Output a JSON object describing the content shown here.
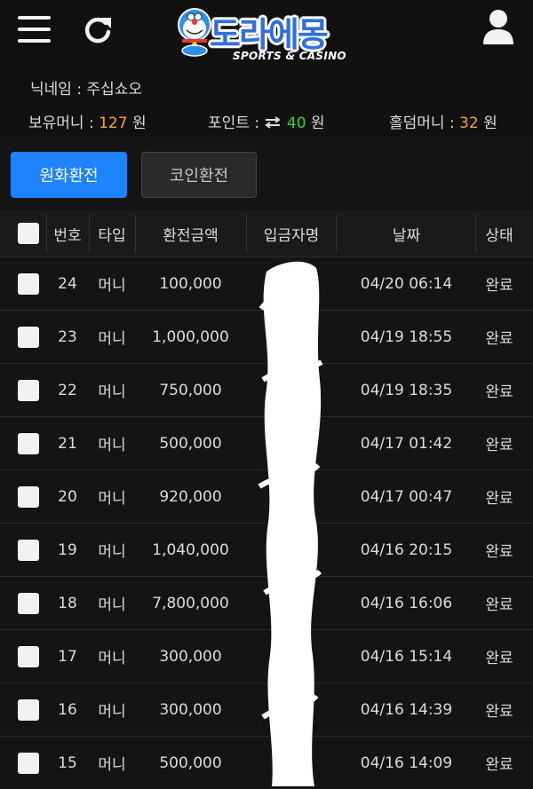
{
  "header": {
    "logo_text": "도라에몽",
    "logo_subtitle": "SPORTS & CASINO"
  },
  "info": {
    "nickname_label": "닉네임 : 주십쇼오",
    "balance_label": "보유머니 : ",
    "balance_value": "127",
    "points_label": "포인트 : ",
    "points_value": "40",
    "holdem_label": "홀덤머니 : ",
    "holdem_value": "32",
    "unit": " 원"
  },
  "tabs": [
    {
      "label": "원화환전",
      "active": true
    },
    {
      "label": "코인환전",
      "active": false
    }
  ],
  "table": {
    "headers": [
      "번호",
      "타입",
      "환전금액",
      "입금자명",
      "날짜",
      "상태"
    ],
    "rows": [
      {
        "no": "24",
        "type": "머니",
        "amount": "100,000",
        "date": "04/20 06:14",
        "status": "완료"
      },
      {
        "no": "23",
        "type": "머니",
        "amount": "1,000,000",
        "date": "04/19 18:55",
        "status": "완료"
      },
      {
        "no": "22",
        "type": "머니",
        "amount": "750,000",
        "date": "04/19 18:35",
        "status": "완료"
      },
      {
        "no": "21",
        "type": "머니",
        "amount": "500,000",
        "date": "04/17 01:42",
        "status": "완료"
      },
      {
        "no": "20",
        "type": "머니",
        "amount": "920,000",
        "date": "04/17 00:47",
        "status": "완료"
      },
      {
        "no": "19",
        "type": "머니",
        "amount": "1,040,000",
        "date": "04/16 20:15",
        "status": "완료"
      },
      {
        "no": "18",
        "type": "머니",
        "amount": "7,800,000",
        "date": "04/16 16:06",
        "status": "완료"
      },
      {
        "no": "17",
        "type": "머니",
        "amount": "300,000",
        "date": "04/16 15:14",
        "status": "완료"
      },
      {
        "no": "16",
        "type": "머니",
        "amount": "300,000",
        "date": "04/16 14:39",
        "status": "완료"
      },
      {
        "no": "15",
        "type": "머니",
        "amount": "500,000",
        "date": "04/16 14:09",
        "status": "완료"
      }
    ]
  },
  "colors": {
    "accent_blue": "#1f83ff",
    "orange": "#f3a33a",
    "green": "#3ec944",
    "background": "#141414"
  },
  "icons": [
    "menu-icon",
    "refresh-icon",
    "user-icon",
    "exchange-arrows-icon"
  ]
}
